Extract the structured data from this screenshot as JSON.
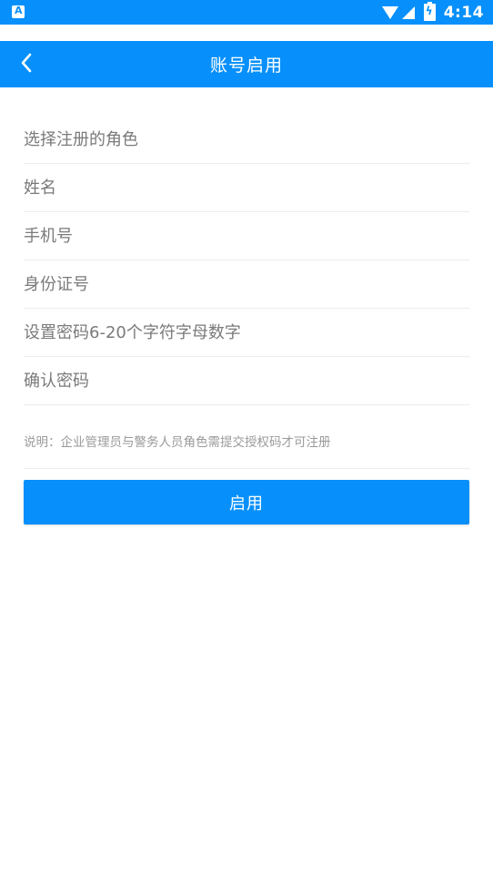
{
  "status_bar": {
    "time": "4:14",
    "icons": [
      "notification-app-icon",
      "wifi-icon",
      "signal-icon",
      "battery-charging-icon"
    ],
    "background_color": "#0790fb"
  },
  "header": {
    "title": "账号启用",
    "back_icon": "chevron-left-icon",
    "background_color": "#0790fb"
  },
  "form": {
    "role": {
      "placeholder": "选择注册的角色",
      "value": ""
    },
    "name": {
      "placeholder": "姓名",
      "value": ""
    },
    "phone": {
      "placeholder": "手机号",
      "value": ""
    },
    "id_number": {
      "placeholder": "身份证号",
      "value": ""
    },
    "password": {
      "placeholder": "设置密码6-20个字符字母数字",
      "value": ""
    },
    "confirm_password": {
      "placeholder": "确认密码",
      "value": ""
    }
  },
  "note": "说明：企业管理员与警务人员角色需提交授权码才可注册",
  "submit_button": {
    "label": "启用",
    "color": "#0790fb"
  }
}
